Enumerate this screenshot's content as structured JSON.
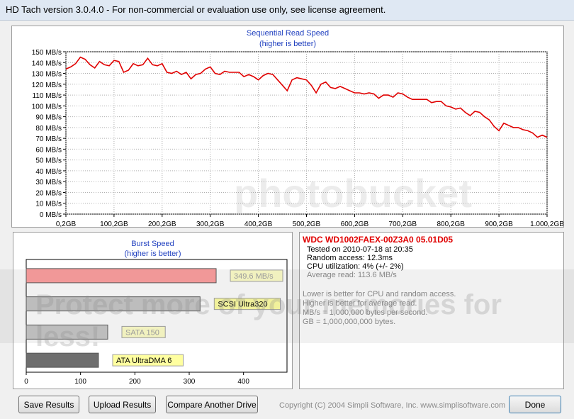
{
  "window": {
    "title": "HD Tach version 3.0.4.0  - For non-commercial or evaluation use only, see license agreement."
  },
  "sequential": {
    "title": "Sequential Read Speed",
    "subtitle": "(higher is better)"
  },
  "chart_data": [
    {
      "type": "line",
      "title": "Sequential Read Speed",
      "subtitle": "(higher is better)",
      "ylim": [
        0,
        150
      ],
      "xlim": [
        0.2,
        1000.2
      ],
      "y_ticks": [
        "150 MB/s",
        "140 MB/s",
        "130 MB/s",
        "120 MB/s",
        "110 MB/s",
        "100 MB/s",
        "90 MB/s",
        "80 MB/s",
        "70 MB/s",
        "60 MB/s",
        "50 MB/s",
        "40 MB/s",
        "30 MB/s",
        "20 MB/s",
        "10 MB/s",
        "0 MB/s"
      ],
      "x_ticks": [
        "0,2GB",
        "100,2GB",
        "200,2GB",
        "300,2GB",
        "400,2GB",
        "500,2GB",
        "600,2GB",
        "700,2GB",
        "800,2GB",
        "900,2GB",
        "1.000,2GB"
      ],
      "line_color": "#e00000",
      "grid": true,
      "series": [
        {
          "x": [
            0,
            10,
            20,
            30,
            40,
            50,
            60,
            70,
            80,
            90,
            100,
            110,
            120,
            130,
            140,
            150,
            160,
            170,
            180,
            190,
            200,
            210,
            220,
            230,
            240,
            250,
            260,
            270,
            280,
            290,
            300,
            310,
            320,
            330,
            340,
            350,
            360,
            370,
            380,
            390,
            400,
            410,
            420,
            430,
            440,
            450,
            460,
            470,
            480,
            490,
            500,
            510,
            520,
            530,
            540,
            550,
            560,
            570,
            580,
            590,
            600,
            610,
            620,
            630,
            640,
            650,
            660,
            670,
            680,
            690,
            700,
            710,
            720,
            730,
            740,
            750,
            760,
            770,
            780,
            790,
            800,
            810,
            820,
            830,
            840,
            850,
            860,
            870,
            880,
            890,
            900,
            910,
            920,
            930,
            940,
            950,
            960,
            970,
            980,
            990,
            1000
          ],
          "y": [
            134,
            136,
            139,
            145,
            143,
            138,
            135,
            141,
            138,
            137,
            142,
            141,
            131,
            133,
            139,
            137,
            138,
            144,
            138,
            137,
            139,
            131,
            130,
            132,
            129,
            131,
            125,
            129,
            130,
            134,
            136,
            130,
            129,
            132,
            131,
            131,
            131,
            127,
            129,
            127,
            124,
            128,
            130,
            129,
            124,
            119,
            114,
            124,
            126,
            125,
            124,
            119,
            112,
            120,
            122,
            117,
            116,
            118,
            116,
            114,
            112,
            112,
            111,
            112,
            111,
            107,
            110,
            110,
            108,
            112,
            111,
            108,
            106,
            106,
            106,
            106,
            103,
            104,
            104,
            100,
            99,
            97,
            98,
            94,
            91,
            95,
            94,
            90,
            87,
            81,
            77,
            84,
            82,
            80,
            80,
            78,
            77,
            75,
            71,
            73,
            71
          ]
        }
      ]
    },
    {
      "type": "bar",
      "title": "Burst Speed",
      "subtitle": "(higher is better)",
      "xlim": [
        0,
        480
      ],
      "x_ticks": [
        "0",
        "100",
        "200",
        "300",
        "400"
      ],
      "categories": [
        "349.6 MB/s",
        "SCSI Ultra320",
        "SATA 150",
        "ATA UltraDMA 6"
      ],
      "values": [
        349.6,
        320,
        150,
        133
      ],
      "colors": [
        "#ff9c9c",
        "#c6c6c6",
        "#c6c6c6",
        "#6e6e6e"
      ],
      "label_bg": [
        "#ffffc8",
        "#ffffa0",
        "#ffffc8",
        "#ffffa0"
      ],
      "label_color": [
        "#a0a0a0",
        "#000000",
        "#a0a0a0",
        "#000000"
      ]
    }
  ],
  "burst": {
    "title": "Burst Speed",
    "subtitle": "(higher is better)"
  },
  "info": {
    "drive": "WDC WD1002FAEX-00Z3A0 05.01D05",
    "tested_on": "Tested on 2010-07-18 at 20:35",
    "random_access": "Random access: 12.3ms",
    "cpu": "CPU utilization: 4% (+/- 2%)",
    "avg_read": "Average read: 113.6 MB/s",
    "note1": "Lower is better for CPU and random access.",
    "note2": "Higher is better for average read.",
    "note3": "MB/s = 1,000,000 bytes per second.",
    "note4": "GB = 1,000,000,000 bytes."
  },
  "buttons": {
    "save": "Save Results",
    "upload": "Upload Results",
    "compare": "Compare Another Drive",
    "done": "Done"
  },
  "copyright": "Copyright (C) 2004 Simpli Software, Inc. www.simplisoftware.com",
  "watermark": {
    "top": "photobucket",
    "banner": "Protect more of your memories for less!"
  }
}
